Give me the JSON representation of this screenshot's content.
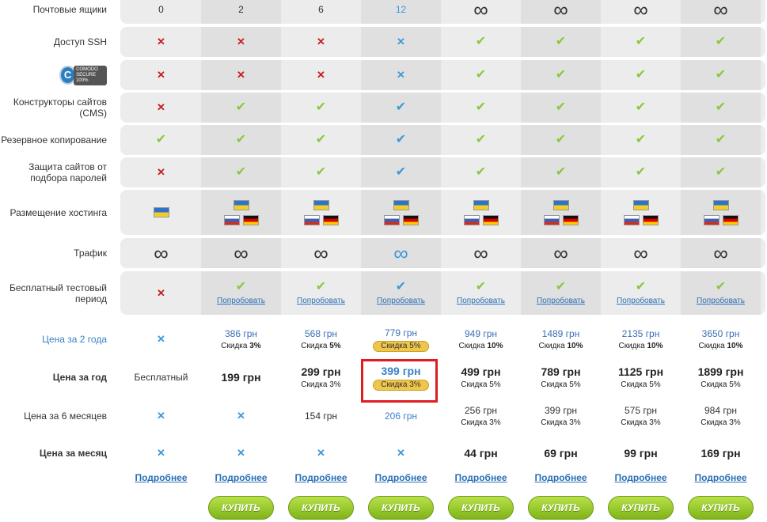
{
  "rows": {
    "mailboxes": {
      "label": "Почтовые ящики",
      "values": [
        "0",
        "2",
        "6",
        "12",
        "∞",
        "∞",
        "∞",
        "∞"
      ]
    },
    "ssh": {
      "label": "Доступ SSH"
    },
    "ssl": {
      "logo_text_top": "COMODO",
      "logo_text_bottom": "SECURE",
      "badge": "100%",
      "icon": "comodo-secure-logo"
    },
    "cms": {
      "label": "Конструкторы сайтов (CMS)"
    },
    "backup": {
      "label": "Резервное копирование"
    },
    "brute": {
      "label": "Защита сайтов от подбора паролей"
    },
    "hosting": {
      "label": "Размещение хостинга"
    },
    "traffic": {
      "label": "Трафик",
      "symbol": "∞"
    },
    "trial": {
      "label": "Бесплатный тестовый период",
      "link": "Попробовать"
    },
    "price2y": {
      "label": "Цена за 2 года",
      "prices": [
        "386 грн",
        "568 грн",
        "779 грн",
        "949 грн",
        "1489 грн",
        "2135 грн",
        "3650 грн"
      ],
      "discount_word": "Скидка",
      "discounts": [
        "3%",
        "5%",
        "5%",
        "10%",
        "10%",
        "10%",
        "10%"
      ]
    },
    "price1y": {
      "label": "Цена за год",
      "free": "Бесплатный",
      "prices": [
        "199 грн",
        "299 грн",
        "399 грн",
        "499 грн",
        "789 грн",
        "1125 грн",
        "1899 грн"
      ],
      "discounts": [
        "",
        "3%",
        "3%",
        "5%",
        "5%",
        "5%",
        "5%"
      ]
    },
    "price6m": {
      "label": "Цена за 6 месяцев",
      "prices": [
        "154 грн",
        "206 грн",
        "256 грн",
        "399 грн",
        "575 грн",
        "984 грн"
      ],
      "discounts": [
        "",
        "",
        "3%",
        "3%",
        "3%",
        "3%"
      ]
    },
    "price1m": {
      "label": "Цена за месяц",
      "prices": [
        "44 грн",
        "69 грн",
        "99 грн",
        "169 грн"
      ]
    }
  },
  "more_link": "Подробнее",
  "buy_button": "КУПИТЬ",
  "colors": {
    "accent": "#3b9ad9",
    "ok": "#8cc63f",
    "cross": "#cc1a1a",
    "highlight": "#e11b22",
    "buy": "#8cc63f"
  }
}
